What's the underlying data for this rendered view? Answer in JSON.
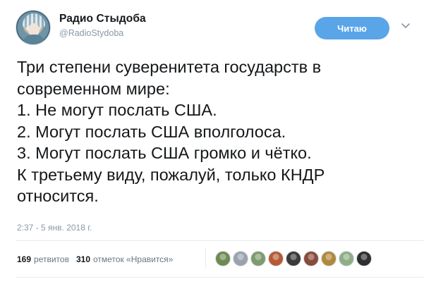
{
  "author": {
    "name": "Радио Стыдоба",
    "handle": "@RadioStydoba",
    "avatar_icon": "avatar-woman-kokoshnik"
  },
  "follow_button": {
    "label": "Читаю"
  },
  "menu_icon": "chevron-down-icon",
  "tweet": {
    "lines": [
      "Три степени суверенитета государств в",
      "современном мире:",
      "1. Не могут послать США.",
      "2. Могут послать США вполголоса.",
      "3. Могут послать США громко и чётко.",
      "К третьему виду, пожалуй, только КНДР",
      "относится."
    ],
    "timestamp": "2:37 - 5 янв. 2018 г."
  },
  "stats": {
    "retweets_count": "169",
    "retweets_label": "ретвитов",
    "likes_count": "310",
    "likes_label": "отметок «Нравится»"
  },
  "likers": [
    {
      "icon": "liker-avatar-1",
      "color": "#6f8a55"
    },
    {
      "icon": "liker-avatar-2",
      "color": "#9aa3ad"
    },
    {
      "icon": "liker-avatar-3",
      "color": "#7f9b6d"
    },
    {
      "icon": "liker-avatar-4",
      "color": "#b65a35"
    },
    {
      "icon": "liker-avatar-5",
      "color": "#3c3a3a"
    },
    {
      "icon": "liker-avatar-6",
      "color": "#8a4a3c"
    },
    {
      "icon": "liker-avatar-7",
      "color": "#b08a3c"
    },
    {
      "icon": "liker-avatar-8",
      "color": "#8fae86"
    },
    {
      "icon": "liker-avatar-9",
      "color": "#2f2f2f"
    }
  ],
  "colors": {
    "accent": "#5aa5e8",
    "text": "#14171a",
    "muted": "#8b98a5",
    "divider": "#e6ecf0"
  }
}
